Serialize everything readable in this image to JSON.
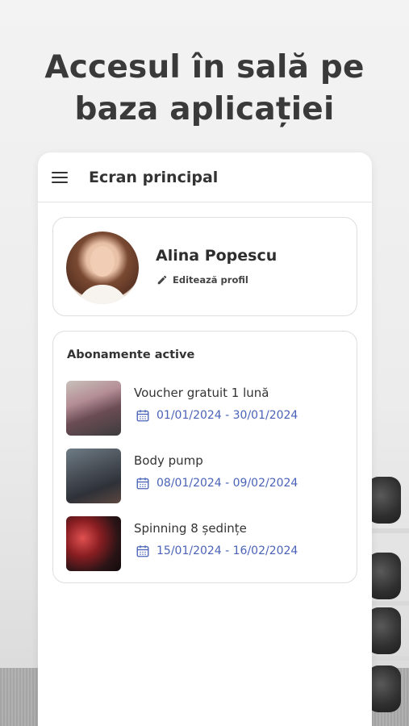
{
  "headline": {
    "line1": "Accesul în sală pe",
    "line2": "baza aplicației"
  },
  "appbar": {
    "title": "Ecran principal",
    "menu_icon": "hamburger-menu-icon"
  },
  "profile": {
    "name": "Alina Popescu",
    "edit_label": "Editează profil",
    "edit_icon": "pencil-icon"
  },
  "subscriptions": {
    "title": "Abonamente active",
    "items": [
      {
        "name": "Voucher gratuit 1 lună",
        "dates": "01/01/2024 - 30/01/2024"
      },
      {
        "name": "Body pump",
        "dates": "08/01/2024 - 09/02/2024"
      },
      {
        "name": "Spinning 8 ședințe",
        "dates": "15/01/2024 - 16/02/2024"
      }
    ]
  },
  "colors": {
    "accent": "#4a63b8",
    "headline": "#3a3a3a",
    "card_border": "#dedede"
  }
}
